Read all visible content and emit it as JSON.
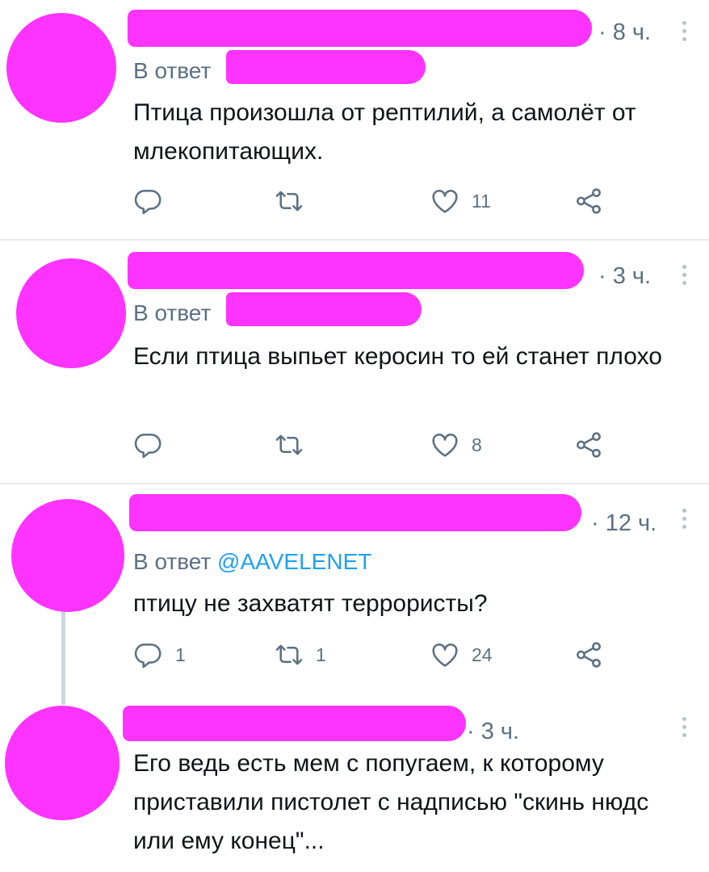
{
  "tweets": [
    {
      "time": "· 8 ч.",
      "reply_prefix": "В ответ",
      "reply_handle": "",
      "text": "Птица произошла от рептилий, а самолёт от млекопитающих.",
      "replies": "",
      "retweets": "",
      "likes": "11"
    },
    {
      "time": "· 3 ч.",
      "reply_prefix": "В ответ",
      "reply_handle": "",
      "text": "Если птица выпьет керосин то ей станет плохо",
      "replies": "",
      "retweets": "",
      "likes": "8"
    },
    {
      "time": "· 12 ч.",
      "reply_prefix": "В ответ",
      "reply_handle": "@AAVELENET",
      "text": "птицу не захватят террористы?",
      "replies": "1",
      "retweets": "1",
      "likes": "24"
    },
    {
      "time": "· 3 ч.",
      "text": "Его ведь есть мем с попугаем, к которому приставили пистолет с надписью \"скинь нюдс или ему конец\"..."
    }
  ],
  "colors": {
    "redaction": "#ff33ff",
    "muted_text": "#5b7083",
    "link": "#1da1f2",
    "divider": "#e6ecf0"
  },
  "icons": [
    "reply-icon",
    "retweet-icon",
    "like-icon",
    "share-icon",
    "more-icon"
  ]
}
